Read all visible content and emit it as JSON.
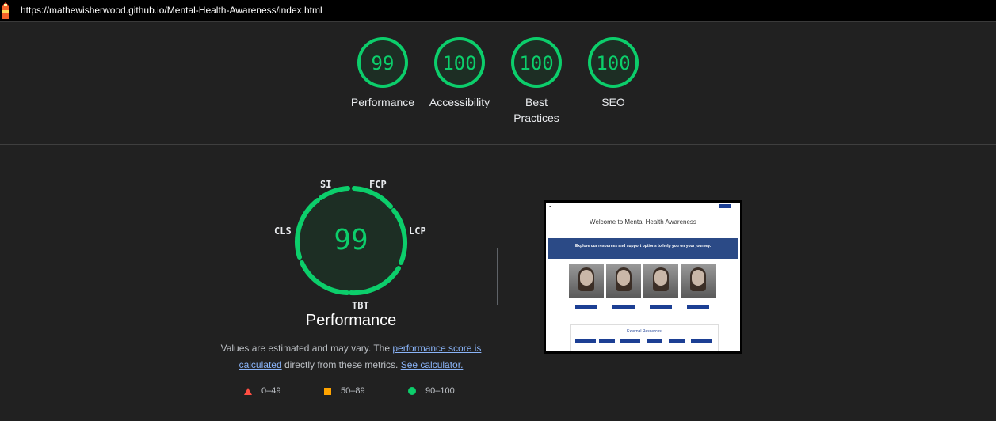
{
  "browser": {
    "url": "https://mathewisherwood.github.io/Mental-Health-Awareness/index.html",
    "logo_icon": "lighthouse-icon"
  },
  "scores": [
    {
      "label": "Performance",
      "value": "99"
    },
    {
      "label": "Accessibility",
      "value": "100"
    },
    {
      "label": "Best Practices",
      "value": "100"
    },
    {
      "label": "SEO",
      "value": "100"
    }
  ],
  "performance": {
    "score": "99",
    "title": "Performance",
    "metrics": {
      "si": "SI",
      "fcp": "FCP",
      "lcp": "LCP",
      "tbt": "TBT",
      "cls": "CLS"
    },
    "desc_before": "Values are estimated and may vary. The ",
    "link_score": "performance score is calculated",
    "desc_middle": " directly from these metrics. ",
    "link_calc": "See calculator."
  },
  "legend": [
    {
      "range": "0–49",
      "icon": "red-triangle-icon",
      "color": "#ff4e42"
    },
    {
      "range": "50–89",
      "icon": "orange-square-icon",
      "color": "#ffa400"
    },
    {
      "range": "90–100",
      "icon": "green-circle-icon",
      "color": "#0cce6b"
    }
  ],
  "thumbnail": {
    "hero_title": "Welcome to Mental Health Awareness",
    "band_text": "Explore our resources and support options to help you on your journey.",
    "section_title": "External Resources"
  },
  "colors": {
    "pass": "#0cce6b",
    "background": "#212121"
  }
}
